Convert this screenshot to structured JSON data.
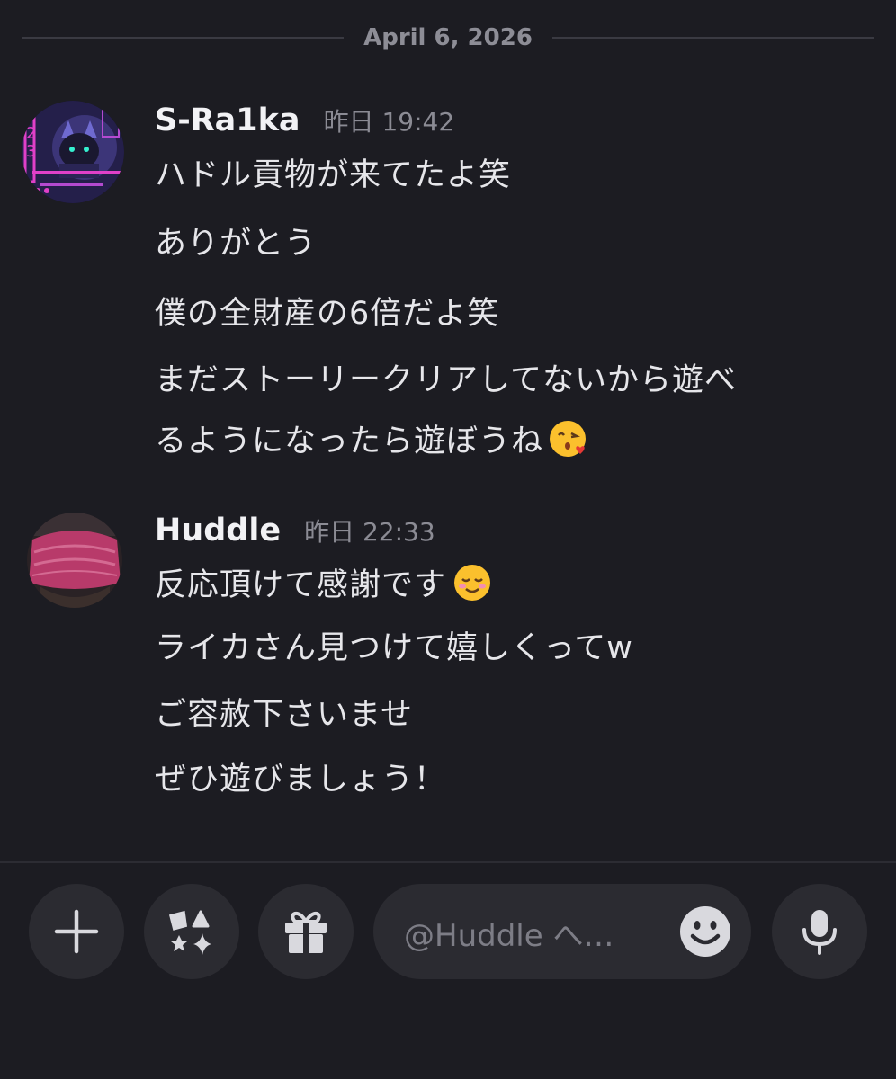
{
  "date_divider": "April 6, 2026",
  "messages": [
    {
      "author": "S-Ra1ka",
      "timestamp": "昨日 19:42",
      "lines": [
        "ハドル貢物が来てたよ笑",
        "ありがとう",
        "僕の全財産の6倍だよ笑",
        "まだストーリークリアしてないから遊べ",
        "るようになったら遊ぼうね"
      ]
    },
    {
      "author": "Huddle",
      "timestamp": "昨日 22:33",
      "lines": [
        "反応頂けて感謝です",
        "ライカさん見つけて嬉しくってw",
        "ご容赦下さいませ",
        "ぜひ遊びましょう！"
      ]
    }
  ],
  "composer": {
    "placeholder": "@Huddle へ…",
    "icons": [
      "plus-icon",
      "apps-icon",
      "gift-icon",
      "emoji-icon",
      "microphone-icon"
    ]
  },
  "colors": {
    "background": "#1c1c22",
    "button": "#2b2b31",
    "muted_text": "#8b8b94",
    "author_text": "#f2f2f5"
  }
}
